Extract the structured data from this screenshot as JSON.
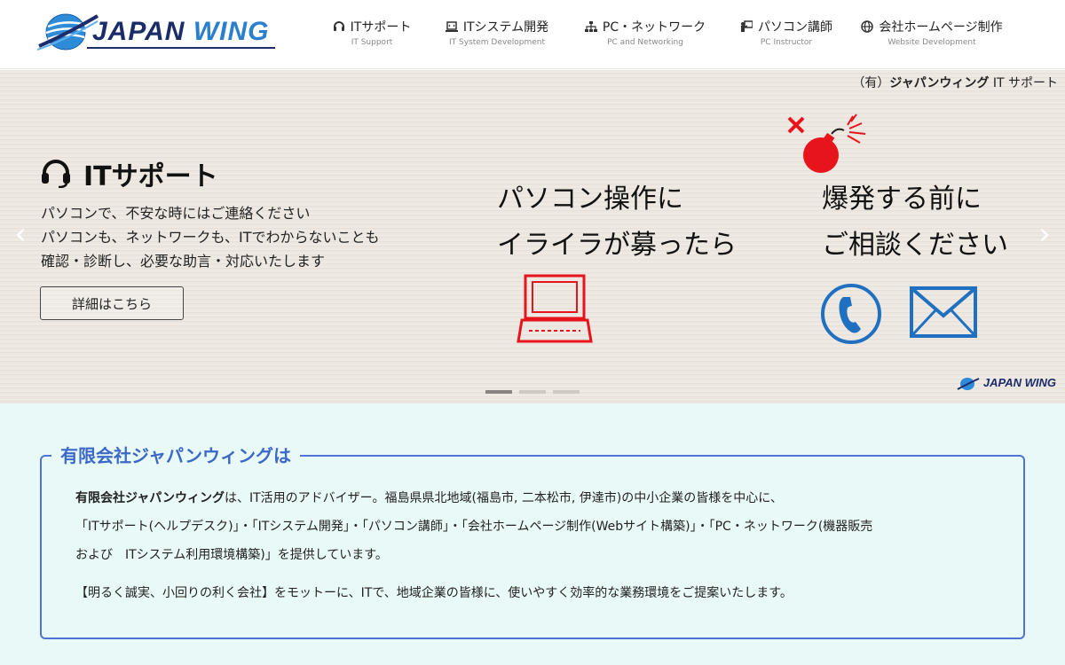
{
  "logo": {
    "text_a": "JAPAN ",
    "text_b": "WING"
  },
  "nav": [
    {
      "icon": "headset-icon",
      "label": "ITサポート",
      "sub": "IT Support"
    },
    {
      "icon": "laptop-code-icon",
      "label": "ITシステム開発",
      "sub": "IT System Development"
    },
    {
      "icon": "network-icon",
      "label": "PC・ネットワーク",
      "sub": "PC and Networking"
    },
    {
      "icon": "instructor-icon",
      "label": "パソコン講師",
      "sub": "PC Instructor"
    },
    {
      "icon": "globe-icon",
      "label": "会社ホームページ制作",
      "sub": "Website Development"
    }
  ],
  "hero": {
    "company_prefix": "（有）",
    "company_name": "ジャパンウィング",
    "company_suffix": " IT サポート",
    "title": "ITサポート",
    "desc": [
      "パソコンで、不安な時にはご連絡ください",
      "パソコンも、ネットワークも、ITでわからないことも",
      "確認・診断し、必要な助言・対応いたします"
    ],
    "button_label": "詳細はこちら",
    "copy_left": [
      "パソコン操作に",
      "イライラが募ったら"
    ],
    "copy_right": [
      "爆発する前に",
      "ご相談ください"
    ],
    "prev_arrow": "‹",
    "next_arrow": "›",
    "slides_total": 3,
    "slide_active": 1,
    "watermark": "JAPAN WING",
    "illustration_color": "#e8141b",
    "contact_color": "#1f70c1"
  },
  "about": {
    "title": "有限会社ジャパンウィングは",
    "company_bold": "有限会社ジャパンウィング",
    "line1_rest": "は、IT活用のアドバイザー。福島県県北地域(福島市, 二本松市, 伊達市)の中小企業の皆様を中心に、",
    "line2": "「ITサポート(ヘルプデスク)」・「ITシステム開発」・「パソコン講師」・「会社ホームページ制作(Webサイト構築)」・「PC・ネットワーク(機器販売",
    "line3": "および　ITシステム利用環境構築)」を提供しています。",
    "motto": "【明るく誠実、小回りの利く会社】をモットーに、ITで、地域企業の皆様に、使いやすく効率的な業務環境をご提案いたします。",
    "accent_color": "#4e74d6"
  }
}
